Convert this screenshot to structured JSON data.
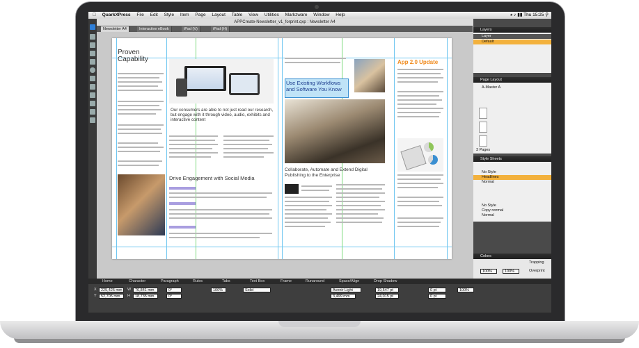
{
  "menubar": {
    "app": "QuarkXPress",
    "items": [
      "File",
      "Edit",
      "Style",
      "Item",
      "Page",
      "Layout",
      "Table",
      "View",
      "Utilities",
      "Markzware",
      "Window",
      "Help"
    ],
    "clock": "Thu 15:25"
  },
  "window": {
    "title": "APPCreate-Newsletter_v1_forprint.qxp : Newsletter A4",
    "tabs": [
      "Newsletter A4",
      "Interactive eBook",
      "iPad (V)",
      "iPad (H)"
    ]
  },
  "page": {
    "heading_proven": "Proven Capability",
    "quote": "Our consumers are able to not just read our research, but engage with it through video, audio, exhibits and interactive content",
    "heading_workflows": "Use Existing Workflows and Software You Know",
    "heading_collaborate": "Collaborate, Automate and Extend Digital Publishing to the Enterprise",
    "heading_drive": "Drive Engagement with Social Media",
    "heading_app": "App 2.0 Update"
  },
  "panels": {
    "layers": {
      "title": "Layers",
      "col_layer": "Layer",
      "default_layer": "Default"
    },
    "page_layout": {
      "title": "Page Layout",
      "master": "A-Master A",
      "pages": "3 Pages"
    },
    "style_sheets": {
      "title": "Style Sheets",
      "para": [
        "No Style",
        "Headlines",
        "Normal"
      ],
      "char": [
        "No Style",
        "Copy normal",
        "Normal"
      ]
    },
    "colors": {
      "title": "Colors",
      "trapping": "Trapping",
      "opacity1": "100%",
      "opacity2": "100%",
      "overprint": "Overprint"
    }
  },
  "measurements": {
    "tabs": [
      "Home",
      "Character",
      "Paragraph",
      "Rules",
      "Tabs",
      "Text Box",
      "Frame",
      "Runaround",
      "Space/Align",
      "Drop Shadow"
    ],
    "x": "225,425 mm",
    "y": "52,705 mm",
    "w": "76,841 mm",
    "h": "18,735 mm",
    "angle1": "0°",
    "angle2": "0°",
    "line_style": "Solid",
    "font": "Avenir Light",
    "size": "3,499 mm",
    "leading": "19,547 pt",
    "tracking": "24,015 pt",
    "shade1": "100%",
    "shade2": "100%",
    "zero1": "0 pt",
    "zero2": "0 pt",
    "zoom": "100%"
  }
}
